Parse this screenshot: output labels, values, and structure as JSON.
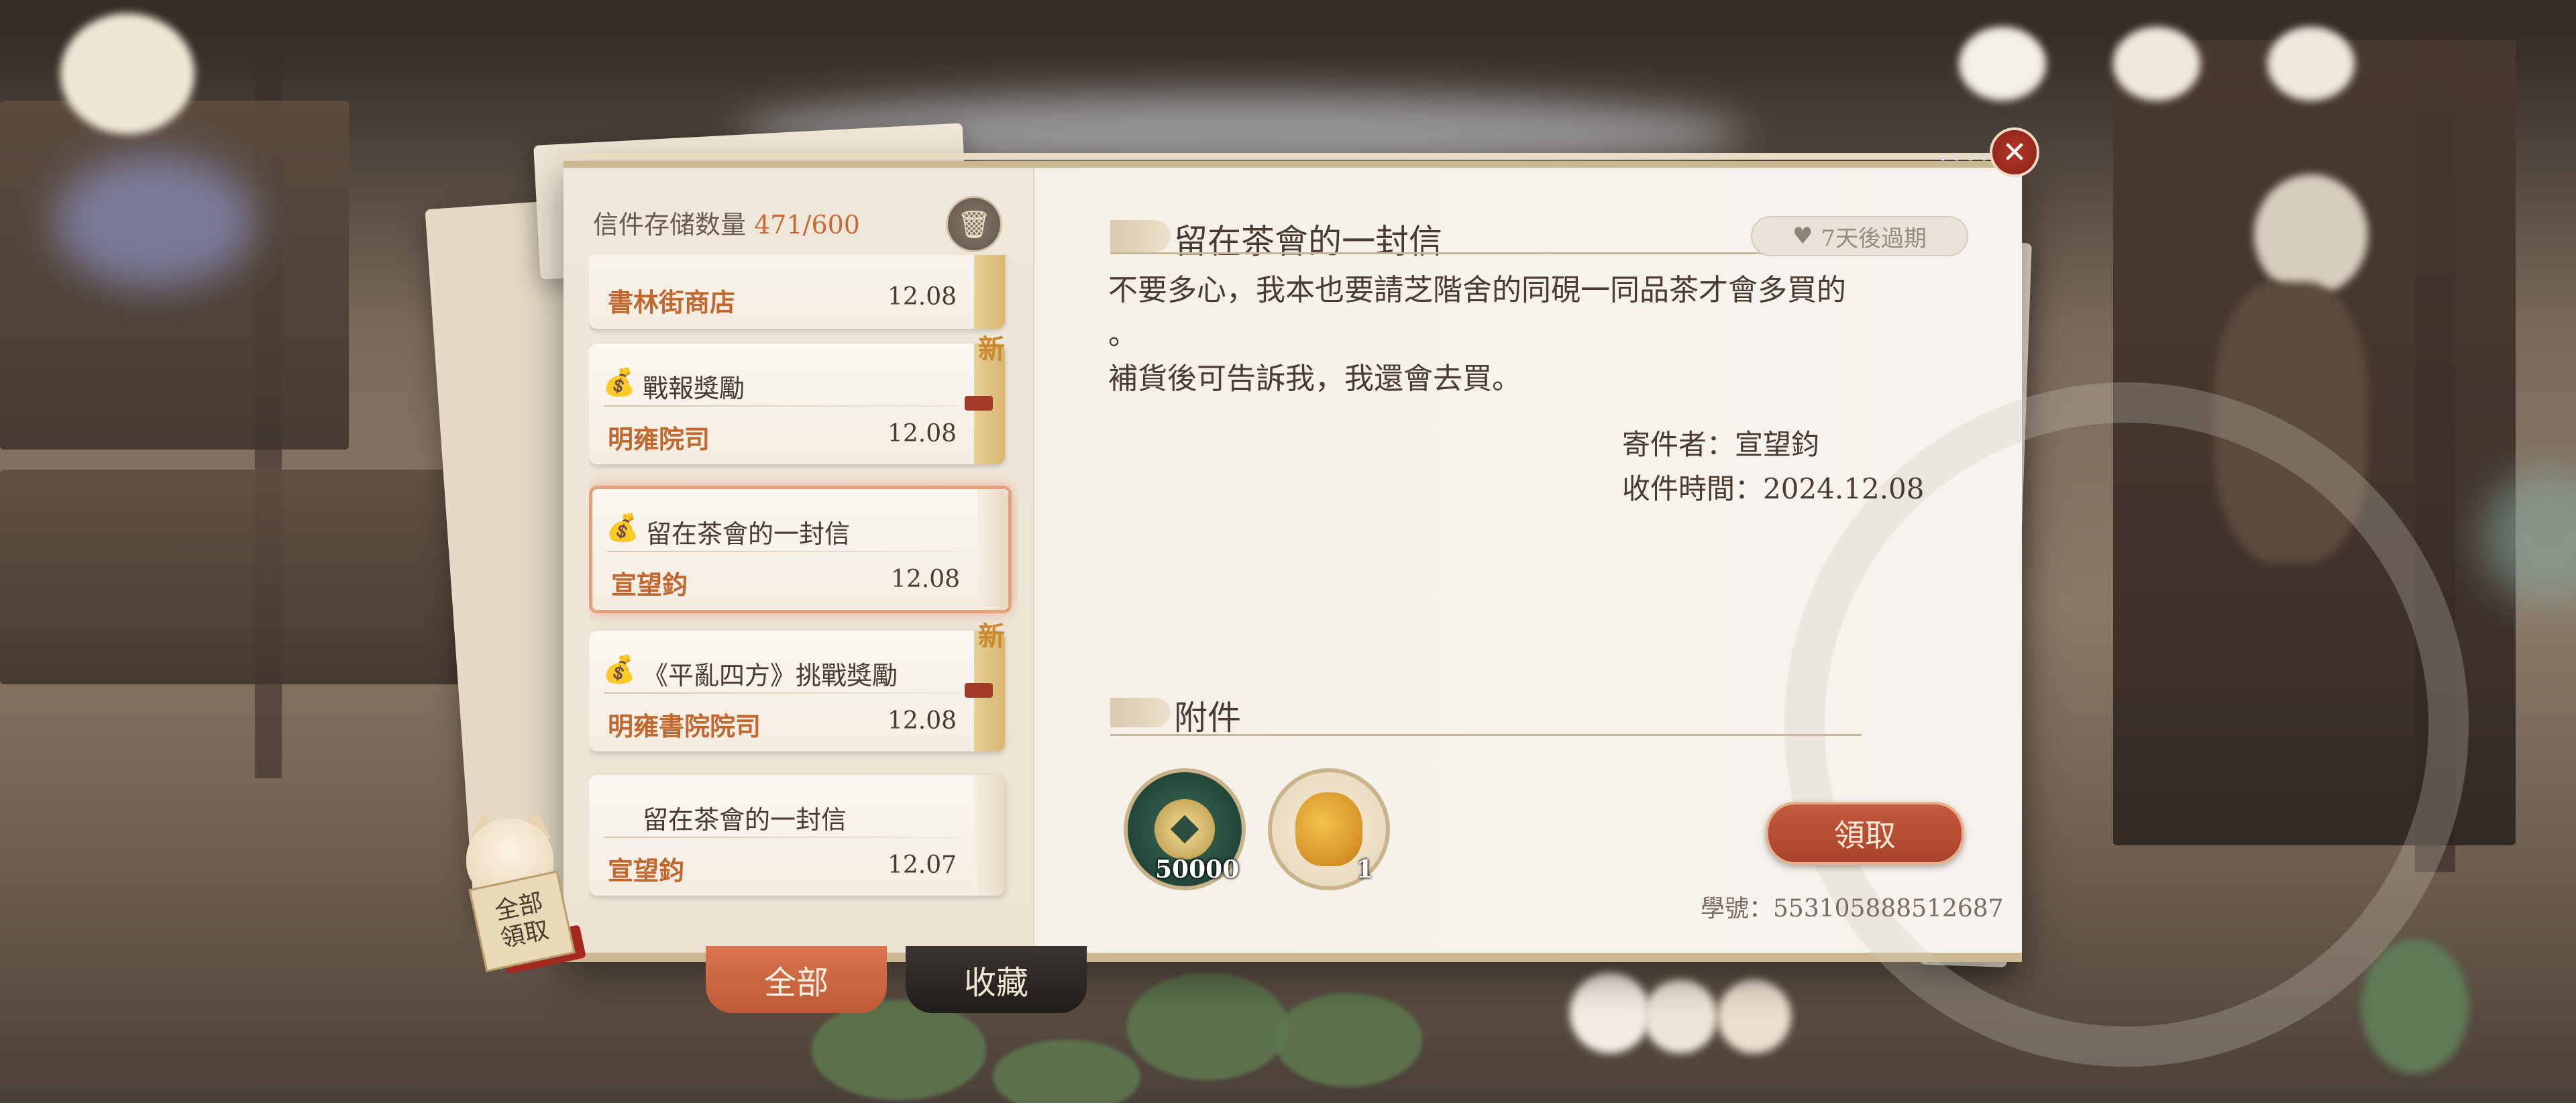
{
  "header": {
    "storage_label": "信件存储数量",
    "storage_count": "471/600"
  },
  "mail_list": [
    {
      "title": "",
      "sender": "書林街商店",
      "date": "12.08",
      "new": false,
      "selected": false,
      "has_icon": false
    },
    {
      "title": "戰報獎勵",
      "sender": "明雍院司",
      "date": "12.08",
      "new": true,
      "new_label": "新",
      "selected": false,
      "has_icon": true
    },
    {
      "title": "留在茶會的一封信",
      "sender": "宣望鈞",
      "date": "12.08",
      "new": false,
      "selected": true,
      "has_icon": true
    },
    {
      "title": "《平亂四方》挑戰獎勵",
      "sender": "明雍書院院司",
      "date": "12.08",
      "new": true,
      "new_label": "新",
      "selected": false,
      "has_icon": true
    },
    {
      "title": "留在茶會的一封信",
      "sender": "宣望鈞",
      "date": "12.07",
      "new": false,
      "selected": false,
      "has_icon": false
    }
  ],
  "mail": {
    "title": "留在茶會的一封信",
    "expire": "7天後過期",
    "body": "不要多心，我本也要請芝階舍的同硯一同品茶才會多買的\n。\n補貨後可告訴我，我還會去買。",
    "sender_label": "寄件者：",
    "sender": "宣望鈞",
    "time_label": "收件時間：",
    "time": "2024.12.08"
  },
  "attachments": {
    "title": "附件",
    "items": [
      {
        "icon": "coin-icon",
        "qty": "50000"
      },
      {
        "icon": "pouch-icon",
        "qty": "1"
      }
    ],
    "claim_label": "領取"
  },
  "student_id_label": "學號：",
  "student_id": "553105888512687",
  "tabs": {
    "all": "全部",
    "favorites": "收藏"
  },
  "claim_all": {
    "line1": "全部",
    "line2": "領取"
  },
  "colors": {
    "accent": "#c96a34",
    "claim_button": "#b34a31",
    "close_button": "#a12c20"
  }
}
